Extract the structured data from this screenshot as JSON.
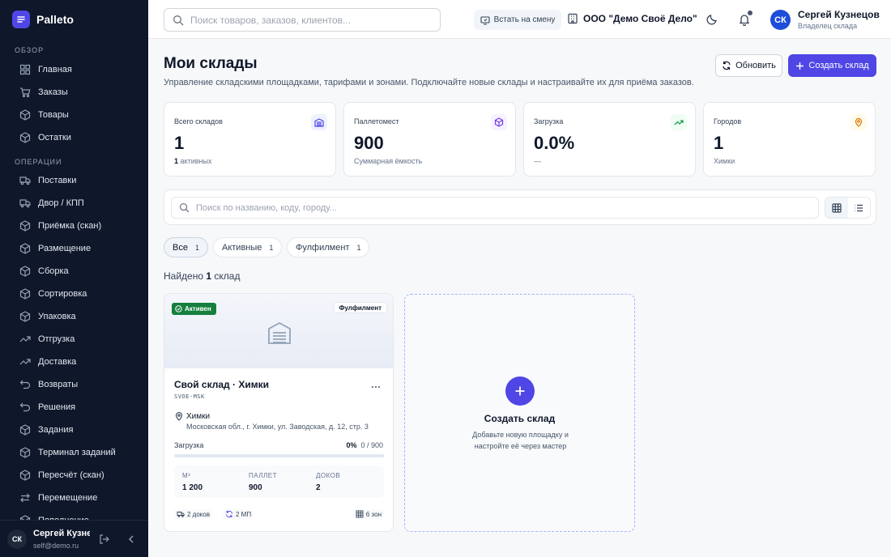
{
  "brand": {
    "name": "Palleto"
  },
  "sidebar": {
    "sections": [
      {
        "label": "ОБЗОР"
      },
      {
        "label": "ОПЕРАЦИИ"
      }
    ],
    "items": [
      {
        "label": "Главная",
        "icon": "home-icon"
      },
      {
        "label": "Заказы",
        "icon": "cart-icon"
      },
      {
        "label": "Товары",
        "icon": "box-icon"
      },
      {
        "label": "Остатки",
        "icon": "box-icon"
      },
      {
        "label": "Поставки",
        "icon": "truck-icon"
      },
      {
        "label": "Двор / КПП",
        "icon": "truck-icon"
      },
      {
        "label": "Приёмка (скан)",
        "icon": "box-icon"
      },
      {
        "label": "Размещение",
        "icon": "box-icon"
      },
      {
        "label": "Сборка",
        "icon": "box-icon"
      },
      {
        "label": "Сортировка",
        "icon": "box-icon"
      },
      {
        "label": "Упаковка",
        "icon": "box-icon"
      },
      {
        "label": "Отгрузка",
        "icon": "trend-icon"
      },
      {
        "label": "Доставка",
        "icon": "trend-icon"
      },
      {
        "label": "Возвраты",
        "icon": "return-icon"
      },
      {
        "label": "Решения",
        "icon": "return-icon"
      },
      {
        "label": "Задания",
        "icon": "box-icon"
      },
      {
        "label": "Терминал заданий",
        "icon": "box-icon"
      },
      {
        "label": "Пересчёт (скан)",
        "icon": "box-icon"
      },
      {
        "label": "Перемещение",
        "icon": "swap-icon"
      },
      {
        "label": "Пополнение",
        "icon": "box-icon"
      }
    ],
    "user": {
      "initials": "СК",
      "name": "Сергей Кузнецов",
      "email": "self@demo.ru"
    }
  },
  "header": {
    "search_placeholder": "Поиск товаров, заказов, клиентов...",
    "shift_button": "Встать на смену",
    "org_name": "ООО \"Демо Своё Дело\"",
    "user": {
      "initials": "СК",
      "name": "Сергей Кузнецов",
      "role": "Владелец склада"
    }
  },
  "page": {
    "title": "Мои склады",
    "subtitle": "Управление складскими площадками, тарифами и зонами. Подключайте новые склады и настраивайте их для приёма заказов.",
    "refresh_button": "Обновить",
    "create_button": "Создать склад"
  },
  "stats": [
    {
      "label": "Всего складов",
      "value": "1",
      "sub_strong": "1",
      "sub": "активных",
      "icon": "warehouse-icon",
      "color": "#4f46e5"
    },
    {
      "label": "Паллетомест",
      "value": "900",
      "sub_strong": "",
      "sub": "Суммарная ёмкость",
      "icon": "cube-icon",
      "color": "#7c3aed"
    },
    {
      "label": "Загрузка",
      "value": "0.0%",
      "sub_strong": "",
      "sub": "—",
      "icon": "trend-up-icon",
      "color": "#16a34a"
    },
    {
      "label": "Городов",
      "value": "1",
      "sub_strong": "",
      "sub": "Химки",
      "icon": "pin-icon",
      "color": "#d97706"
    }
  ],
  "filter": {
    "search_placeholder": "Поиск по названию, коду, городу...",
    "view_modes": [
      "grid-view-icon",
      "list-view-icon"
    ]
  },
  "tabs": [
    {
      "label": "Все",
      "count": "1"
    },
    {
      "label": "Активные",
      "count": "1"
    },
    {
      "label": "Фулфилмент",
      "count": "1"
    }
  ],
  "found": {
    "prefix": "Найдено",
    "count": "1",
    "suffix": "склад"
  },
  "warehouse": {
    "status": "Активен",
    "type": "Фулфилмент",
    "name": "Свой склад · Химки",
    "code": "SVOE-MSK",
    "city": "Химки",
    "address": "Московская обл., г. Химки, ул. Заводская, д. 12, стр. 3",
    "load_label": "Загрузка",
    "load_percent": "0%",
    "load_detail": "0 / 900",
    "load_fraction": 0,
    "metrics": [
      {
        "label": "М²",
        "value": "1 200"
      },
      {
        "label": "ПАЛЛЕТ",
        "value": "900"
      },
      {
        "label": "ДОКОВ",
        "value": "2"
      }
    ],
    "tags": [
      {
        "label": "2 доков"
      },
      {
        "label": "2 МП"
      }
    ],
    "zones": "6 зон"
  },
  "create_card": {
    "title": "Создать склад",
    "description": "Добавьте новую площадку и настройте её через мастер"
  }
}
